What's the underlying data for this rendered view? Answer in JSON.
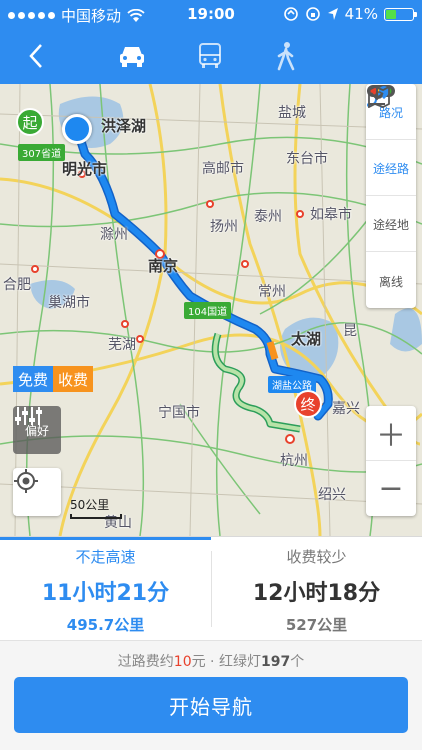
{
  "status_bar": {
    "carrier": "中国移动",
    "time": "19:00",
    "battery": "41%",
    "battery_level": 0.41
  },
  "nav": {
    "modes": [
      "car-icon",
      "bus-icon",
      "walk-icon"
    ],
    "selected": "car"
  },
  "map": {
    "cities": [
      "洪泽湖",
      "明光市",
      "盐城",
      "高邮市",
      "东台市",
      "滁州",
      "扬州",
      "泰州",
      "如皋市",
      "合肥",
      "巢湖市",
      "南京",
      "常州",
      "昆",
      "芜湖",
      "太湖",
      "宁国市",
      "嘉兴",
      "杭州",
      "绍兴",
      "黄山"
    ],
    "road_labels": {
      "s307": "307省道",
      "g104": "104国道",
      "hushen": "湖盐公路"
    },
    "start_marker": "起",
    "end_marker": "终"
  },
  "right_panel": [
    "路况",
    "途经路",
    "途经地",
    "离线"
  ],
  "toll_tabs": {
    "free": "免费",
    "toll": "收费"
  },
  "preference": "偏好",
  "scale": "50公里",
  "routes": [
    {
      "tag": "不走高速",
      "duration": "11小时21分",
      "distance": "495.7公里"
    },
    {
      "tag": "收费较少",
      "duration": "12小时18分",
      "distance": "527公里"
    }
  ],
  "info": {
    "toll_prefix": "过路费约",
    "toll_value": "10",
    "toll_unit": "元 · 红绿灯",
    "lights_value": "197",
    "lights_unit": "个"
  },
  "start_button": "开始导航",
  "colors": {
    "accent": "#2e8cf0",
    "toll_orange": "#f7931e",
    "start_green": "#3aaa35",
    "end_red": "#e8412c"
  }
}
